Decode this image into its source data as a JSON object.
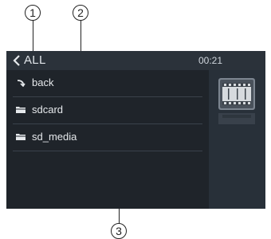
{
  "callouts": [
    "1",
    "2",
    "3"
  ],
  "header": {
    "title": "ALL",
    "time": "00:21"
  },
  "list": {
    "items": [
      {
        "label": "back",
        "icon": "return-arrow-icon"
      },
      {
        "label": "sdcard",
        "icon": "folder-icon"
      },
      {
        "label": "sd_media",
        "icon": "folder-icon"
      }
    ]
  },
  "preview": {
    "icon": "film-strip-icon"
  },
  "colors": {
    "background": "#1f242a",
    "topbar": "#2b323a",
    "pane": "#283039",
    "text": "#e6e9ec"
  }
}
